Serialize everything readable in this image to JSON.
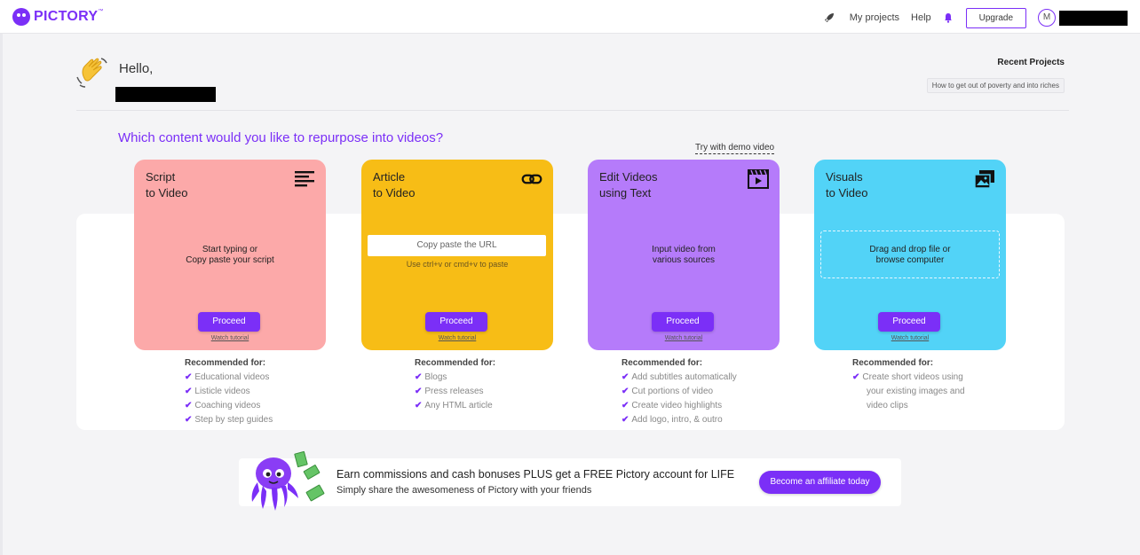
{
  "header": {
    "logo_text": "PICTORY",
    "logo_tm": "™",
    "nav": {
      "my_projects": "My projects",
      "help": "Help",
      "upgrade": "Upgrade",
      "avatar_initial": "M"
    },
    "icons": [
      "rocket-icon",
      "bell-icon"
    ]
  },
  "greeting": {
    "hello": "Hello,",
    "recent_title": "Recent Projects",
    "recent_items": [
      "How to get out of poverty and into riches"
    ]
  },
  "main": {
    "question": "Which content would you like to repurpose into videos?",
    "demo_link": "Try with demo video",
    "cards": [
      {
        "title_line1": "Script",
        "title_line2": "to Video",
        "icon": "text-lines-icon",
        "desc_line1": "Start typing or",
        "desc_line2": "Copy paste your script",
        "proceed": "Proceed",
        "tutorial": "Watch tutorial",
        "color": "#fca9a9"
      },
      {
        "title_line1": "Article",
        "title_line2": "to Video",
        "icon": "link-icon",
        "url_placeholder": "Copy paste the URL",
        "hint": "Use ctrl+v or cmd+v to paste",
        "proceed": "Proceed",
        "tutorial": "Watch tutorial",
        "color": "#f7bd16"
      },
      {
        "title_line1": "Edit Videos",
        "title_line2": "using Text",
        "icon": "clapperboard-icon",
        "desc_line1": "Input video from",
        "desc_line2": "various sources",
        "proceed": "Proceed",
        "tutorial": "Watch tutorial",
        "color": "#b57bfa"
      },
      {
        "title_line1": "Visuals",
        "title_line2": "to Video",
        "icon": "images-icon",
        "desc_line1": "Drag and drop file or",
        "desc_line2": "browse computer",
        "proceed": "Proceed",
        "tutorial": "Watch tutorial",
        "color": "#52d3f7"
      }
    ],
    "recommended_heading": "Recommended for:",
    "recommended": [
      [
        "Educational videos",
        "Listicle videos",
        "Coaching videos",
        "Step by step guides"
      ],
      [
        "Blogs",
        "Press releases",
        "Any HTML article"
      ],
      [
        "Add subtitles automatically",
        "Cut portions of video",
        "Create video highlights",
        "Add logo, intro, & outro"
      ],
      [
        "Create short videos using",
        "your existing images and",
        "video clips"
      ]
    ]
  },
  "banner": {
    "line1": "Earn commissions and cash bonuses PLUS get a FREE Pictory account for LIFE",
    "line2": "Simply share the awesomeness of Pictory with your friends",
    "button": "Become an affiliate today"
  },
  "colors": {
    "accent": "#7b2ff7"
  }
}
